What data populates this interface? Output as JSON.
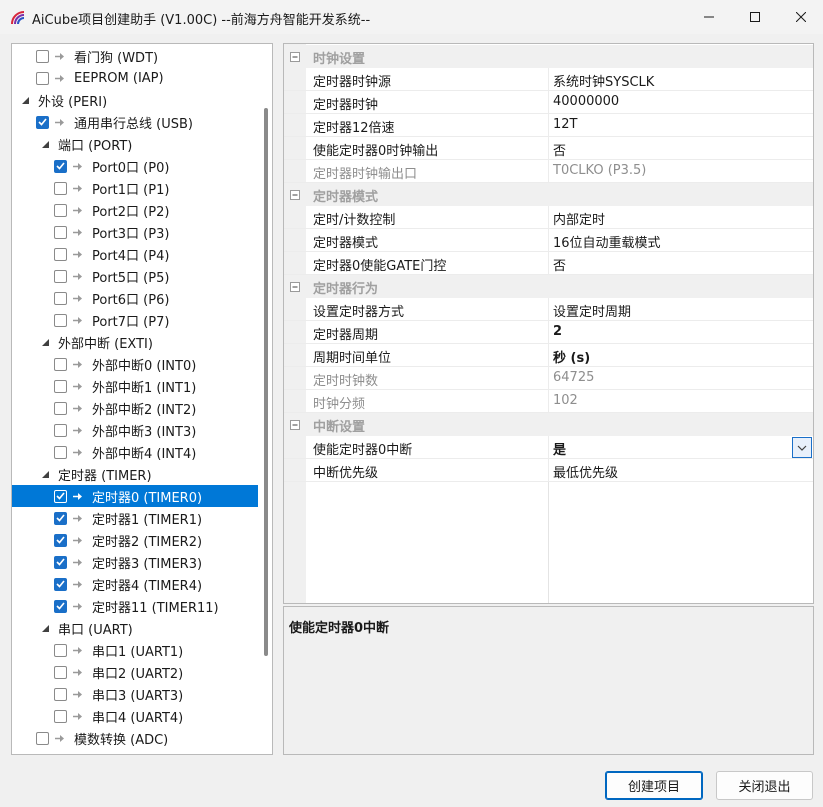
{
  "window": {
    "title": "AiCube项目创建助手 (V1.00C) --前海方舟智能开发系统--",
    "minimize_glyph": "—",
    "maximize_glyph": "☐",
    "close_glyph": "✕"
  },
  "tree": {
    "items": [
      {
        "label": "看门狗 (WDT)",
        "level": 1,
        "kind": "leaf",
        "checked": false
      },
      {
        "label": "EEPROM (IAP)",
        "level": 1,
        "kind": "leaf",
        "checked": false
      },
      {
        "label": "外设 (PERI)",
        "level": 0,
        "kind": "group",
        "expanded": true
      },
      {
        "label": "通用串行总线 (USB)",
        "level": 1,
        "kind": "leaf",
        "checked": true
      },
      {
        "label": "端口 (PORT)",
        "level": 1,
        "kind": "group",
        "expanded": true
      },
      {
        "label": "Port0口 (P0)",
        "level": 2,
        "kind": "leaf",
        "checked": true
      },
      {
        "label": "Port1口 (P1)",
        "level": 2,
        "kind": "leaf",
        "checked": false
      },
      {
        "label": "Port2口 (P2)",
        "level": 2,
        "kind": "leaf",
        "checked": false
      },
      {
        "label": "Port3口 (P3)",
        "level": 2,
        "kind": "leaf",
        "checked": false
      },
      {
        "label": "Port4口 (P4)",
        "level": 2,
        "kind": "leaf",
        "checked": false
      },
      {
        "label": "Port5口 (P5)",
        "level": 2,
        "kind": "leaf",
        "checked": false
      },
      {
        "label": "Port6口 (P6)",
        "level": 2,
        "kind": "leaf",
        "checked": false
      },
      {
        "label": "Port7口 (P7)",
        "level": 2,
        "kind": "leaf",
        "checked": false
      },
      {
        "label": "外部中断 (EXTI)",
        "level": 1,
        "kind": "group",
        "expanded": true
      },
      {
        "label": "外部中断0 (INT0)",
        "level": 2,
        "kind": "leaf",
        "checked": false
      },
      {
        "label": "外部中断1 (INT1)",
        "level": 2,
        "kind": "leaf",
        "checked": false
      },
      {
        "label": "外部中断2 (INT2)",
        "level": 2,
        "kind": "leaf",
        "checked": false
      },
      {
        "label": "外部中断3 (INT3)",
        "level": 2,
        "kind": "leaf",
        "checked": false
      },
      {
        "label": "外部中断4 (INT4)",
        "level": 2,
        "kind": "leaf",
        "checked": false
      },
      {
        "label": "定时器 (TIMER)",
        "level": 1,
        "kind": "group",
        "expanded": true
      },
      {
        "label": "定时器0 (TIMER0)",
        "level": 2,
        "kind": "leaf",
        "checked": true,
        "selected": true
      },
      {
        "label": "定时器1 (TIMER1)",
        "level": 2,
        "kind": "leaf",
        "checked": true
      },
      {
        "label": "定时器2 (TIMER2)",
        "level": 2,
        "kind": "leaf",
        "checked": true
      },
      {
        "label": "定时器3 (TIMER3)",
        "level": 2,
        "kind": "leaf",
        "checked": true
      },
      {
        "label": "定时器4 (TIMER4)",
        "level": 2,
        "kind": "leaf",
        "checked": true
      },
      {
        "label": "定时器11 (TIMER11)",
        "level": 2,
        "kind": "leaf",
        "checked": true
      },
      {
        "label": "串口 (UART)",
        "level": 1,
        "kind": "group",
        "expanded": true
      },
      {
        "label": "串口1 (UART1)",
        "level": 2,
        "kind": "leaf",
        "checked": false
      },
      {
        "label": "串口2 (UART2)",
        "level": 2,
        "kind": "leaf",
        "checked": false
      },
      {
        "label": "串口3 (UART3)",
        "level": 2,
        "kind": "leaf",
        "checked": false
      },
      {
        "label": "串口4 (UART4)",
        "level": 2,
        "kind": "leaf",
        "checked": false
      },
      {
        "label": "模数转换 (ADC)",
        "level": 1,
        "kind": "leaf",
        "checked": false
      }
    ]
  },
  "grid": {
    "rows": [
      {
        "type": "cat",
        "name": "时钟设置"
      },
      {
        "type": "prop",
        "name": "定时器时钟源",
        "value": "系统时钟SYSCLK"
      },
      {
        "type": "prop",
        "name": "定时器时钟",
        "value": "40000000"
      },
      {
        "type": "prop",
        "name": "定时器12倍速",
        "value": "12T"
      },
      {
        "type": "prop",
        "name": "使能定时器0时钟输出",
        "value": "否"
      },
      {
        "type": "prop",
        "name": "定时器时钟输出口",
        "value": "T0CLKO (P3.5)",
        "disabled": true
      },
      {
        "type": "cat",
        "name": "定时器模式"
      },
      {
        "type": "prop",
        "name": "定时/计数控制",
        "value": "内部定时"
      },
      {
        "type": "prop",
        "name": "定时器模式",
        "value": "16位自动重载模式"
      },
      {
        "type": "prop",
        "name": "定时器0使能GATE门控",
        "value": "否"
      },
      {
        "type": "cat",
        "name": "定时器行为"
      },
      {
        "type": "prop",
        "name": "设置定时器方式",
        "value": "设置定时周期"
      },
      {
        "type": "prop",
        "name": "定时器周期",
        "value": "2",
        "bold": true
      },
      {
        "type": "prop",
        "name": "周期时间单位",
        "value": "秒 (s)",
        "bold": true
      },
      {
        "type": "prop",
        "name": "定时时钟数",
        "value": "64725",
        "disabled": true
      },
      {
        "type": "prop",
        "name": "时钟分频",
        "value": "102",
        "disabled": true
      },
      {
        "type": "cat",
        "name": "中断设置"
      },
      {
        "type": "prop",
        "name": "使能定时器0中断",
        "value": "是",
        "focused": true
      },
      {
        "type": "prop",
        "name": "中断优先级",
        "value": "最低优先级"
      }
    ]
  },
  "description": {
    "title": "使能定时器0中断"
  },
  "buttons": {
    "create": "创建项目",
    "close": "关闭退出"
  },
  "colors": {
    "accent": "#0078d7",
    "checkbox": "#1a6fc8",
    "category_text": "#a0a0a0"
  }
}
